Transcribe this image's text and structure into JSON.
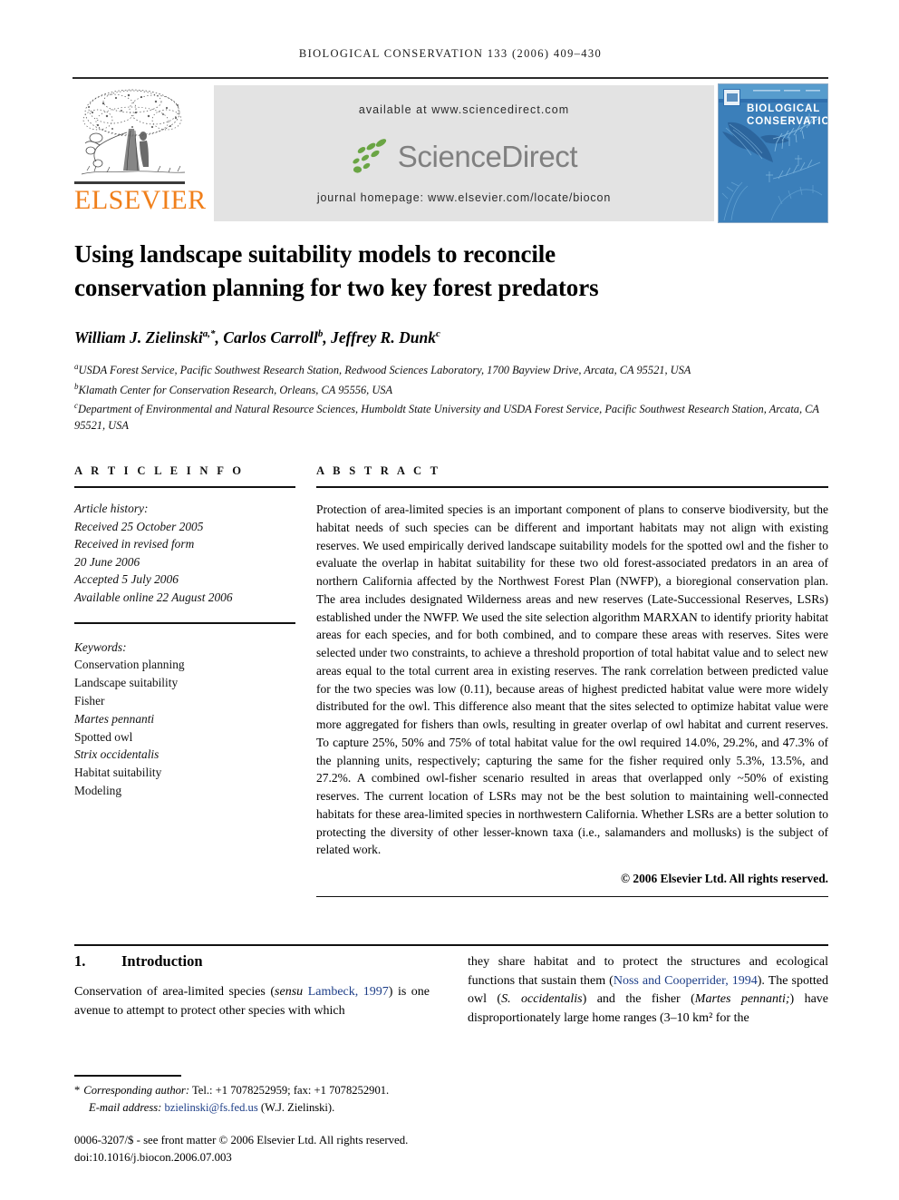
{
  "running_head": "BIOLOGICAL CONSERVATION 133 (2006) 409–430",
  "masthead": {
    "elsevier_wordmark": "ELSEVIER",
    "available_at": "available at www.sciencedirect.com",
    "sciencedirect_logo_text": "ScienceDirect",
    "journal_homepage": "journal homepage: www.elsevier.com/locate/biocon",
    "cover_title_line1": "BIOLOGICAL",
    "cover_title_line2": "CONSERVATION",
    "colors": {
      "elsevier_orange": "#F07F1A",
      "banner_gray": "#e3e3e3",
      "sciencedirect_green": "#6aa544",
      "sciencedirect_gray": "#808080",
      "cover_blue": "#2f6fae",
      "citation_link": "#1c3d87"
    }
  },
  "article": {
    "title_line1": "Using landscape suitability models to reconcile",
    "title_line2": "conservation planning for two key forest predators",
    "authors": [
      {
        "name": "William J. Zielinski",
        "sup": "a,*"
      },
      {
        "name": "Carlos Carroll",
        "sup": "b"
      },
      {
        "name": "Jeffrey R. Dunk",
        "sup": "c"
      }
    ],
    "affiliations": [
      {
        "marker": "a",
        "text": "USDA Forest Service, Pacific Southwest Research Station, Redwood Sciences Laboratory, 1700 Bayview Drive, Arcata, CA 95521, USA"
      },
      {
        "marker": "b",
        "text": "Klamath Center for Conservation Research, Orleans, CA 95556, USA"
      },
      {
        "marker": "c",
        "text": "Department of Environmental and Natural Resource Sciences, Humboldt State University and USDA Forest Service, Pacific Southwest Research Station, Arcata, CA 95521, USA"
      }
    ]
  },
  "article_info": {
    "heading": "A R T I C L E   I N F O",
    "history_label": "Article history:",
    "history": [
      "Received 25 October 2005",
      "Received in revised form",
      "20 June 2006",
      "Accepted 5 July 2006",
      "Available online 22 August 2006"
    ],
    "keywords_label": "Keywords:",
    "keywords": [
      {
        "text": "Conservation planning",
        "italic": false
      },
      {
        "text": "Landscape suitability",
        "italic": false
      },
      {
        "text": "Fisher",
        "italic": false
      },
      {
        "text": "Martes pennanti",
        "italic": true
      },
      {
        "text": "Spotted owl",
        "italic": false
      },
      {
        "text": "Strix occidentalis",
        "italic": true
      },
      {
        "text": "Habitat suitability",
        "italic": false
      },
      {
        "text": "Modeling",
        "italic": false
      }
    ]
  },
  "abstract": {
    "heading": "A B S T R A C T",
    "text": "Protection of area-limited species is an important component of plans to conserve biodiversity, but the habitat needs of such species can be different and important habitats may not align with existing reserves. We used empirically derived landscape suitability models for the spotted owl and the fisher to evaluate the overlap in habitat suitability for these two old forest-associated predators in an area of northern California affected by the Northwest Forest Plan (NWFP), a bioregional conservation plan. The area includes designated Wilderness areas and new reserves (Late-Successional Reserves, LSRs) established under the NWFP. We used the site selection algorithm MARXAN to identify priority habitat areas for each species, and for both combined, and to compare these areas with reserves. Sites were selected under two constraints, to achieve a threshold proportion of total habitat value and to select new areas equal to the total current area in existing reserves. The rank correlation between predicted value for the two species was low (0.11), because areas of highest predicted habitat value were more widely distributed for the owl. This difference also meant that the sites selected to optimize habitat value were more aggregated for fishers than owls, resulting in greater overlap of owl habitat and current reserves. To capture 25%, 50% and 75% of total habitat value for the owl required 14.0%, 29.2%, and 47.3% of the planning units, respectively; capturing the same for the fisher required only 5.3%, 13.5%, and 27.2%. A combined owl-fisher scenario resulted in areas that overlapped only ~50% of existing reserves. The current location of LSRs may not be the best solution to maintaining well-connected habitats for these area-limited species in northwestern California. Whether LSRs are a better solution to protecting the diversity of other lesser-known taxa (i.e., salamanders and mollusks) is the subject of related work.",
    "copyright": "© 2006 Elsevier Ltd. All rights reserved."
  },
  "introduction": {
    "number": "1.",
    "title": "Introduction",
    "left_before_cite": "Conservation of area-limited species (",
    "left_sensu": "sensu",
    "left_citation": "Lambeck, 1997",
    "left_after_cite": ") is one avenue to attempt to protect other species with which",
    "right_before_cite": "they share habitat and to protect the structures and ecological functions that sustain them (",
    "right_citation": "Noss and Cooperrider, 1994",
    "right_mid": "). The spotted owl (",
    "right_sp1": "S. occidentalis",
    "right_mid2": ") and the fisher (",
    "right_sp2": "Martes pennanti;",
    "right_after": ") have disproportionately large home ranges (3–10 km² for the"
  },
  "footnote": {
    "star": "*",
    "corresponding_label": "Corresponding author:",
    "corresponding_rest": "Tel.: +1 7078252959; fax: +1 7078252901.",
    "email_label": "E-mail address:",
    "email": "bzielinski@fs.fed.us",
    "email_owner": "(W.J. Zielinski).",
    "imprint_line1": "0006-3207/$ - see front matter © 2006 Elsevier Ltd. All rights reserved.",
    "imprint_line2": "doi:10.1016/j.biocon.2006.07.003"
  }
}
